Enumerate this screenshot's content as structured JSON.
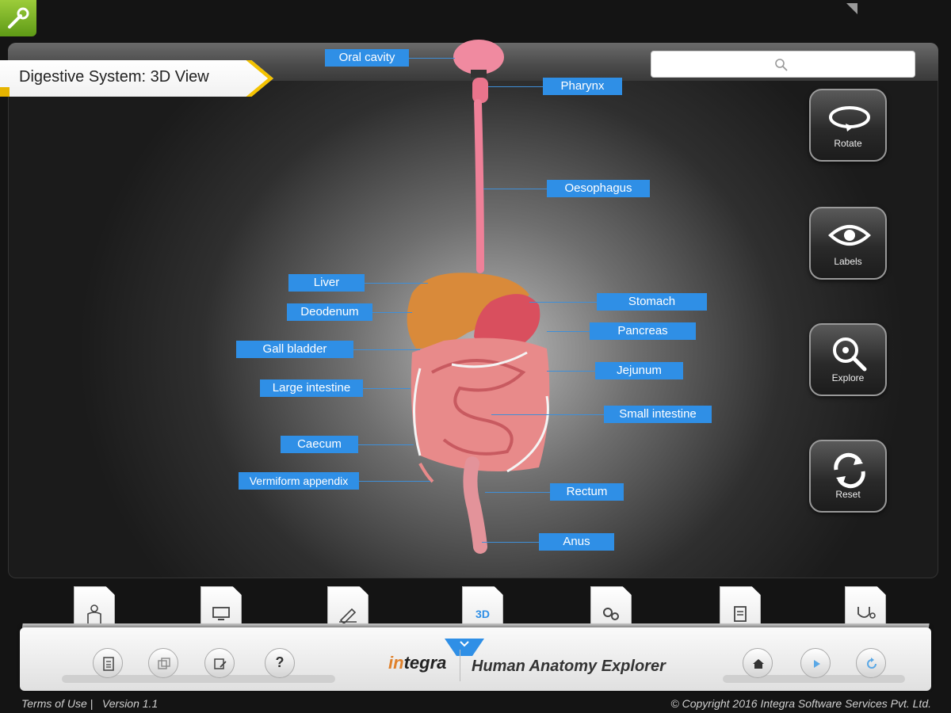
{
  "app": {
    "view_title": "Digestive System: 3D View",
    "brand": {
      "prefix": "in",
      "rest": "tegra"
    },
    "app_name": "Human Anatomy Explorer"
  },
  "search": {
    "placeholder": ""
  },
  "controls": [
    {
      "label": "Rotate",
      "icon": "rotate-icon"
    },
    {
      "label": "Labels",
      "icon": "eye-icon"
    },
    {
      "label": "Explore",
      "icon": "explore-magnifier-icon"
    },
    {
      "label": "Reset",
      "icon": "reset-arrows-icon"
    }
  ],
  "labels": {
    "oral_cavity": "Oral cavity",
    "pharynx": "Pharynx",
    "oesophagus": "Oesophagus",
    "liver": "Liver",
    "duodenum": "Deodenum",
    "stomach": "Stomach",
    "pancreas": "Pancreas",
    "gall_bladder": "Gall bladder",
    "jejunum": "Jejunum",
    "large_intestine": "Large intestine",
    "small_intestine": "Small intestine",
    "caecum": "Caecum",
    "vermiform_appendix": "Vermiform appendix",
    "rectum": "Rectum",
    "anus": "Anus"
  },
  "tabs": [
    {
      "icon": "body-outline-icon"
    },
    {
      "icon": "monitor-icon"
    },
    {
      "icon": "pen-edit-icon"
    },
    {
      "label": "3D"
    },
    {
      "icon": "gears-icon"
    },
    {
      "icon": "document-icon"
    },
    {
      "icon": "stethoscope-icon"
    }
  ],
  "toolbar": {
    "help_label": "?"
  },
  "footer": {
    "left": "Terms of Use |   Version 1.1",
    "right": "© Copyright 2016 Integra Software Services Pvt. Ltd."
  },
  "colors": {
    "label_bg": "#2f8fe6",
    "banner_accent": "#f3c200",
    "wrench_green": "#7fb327"
  }
}
